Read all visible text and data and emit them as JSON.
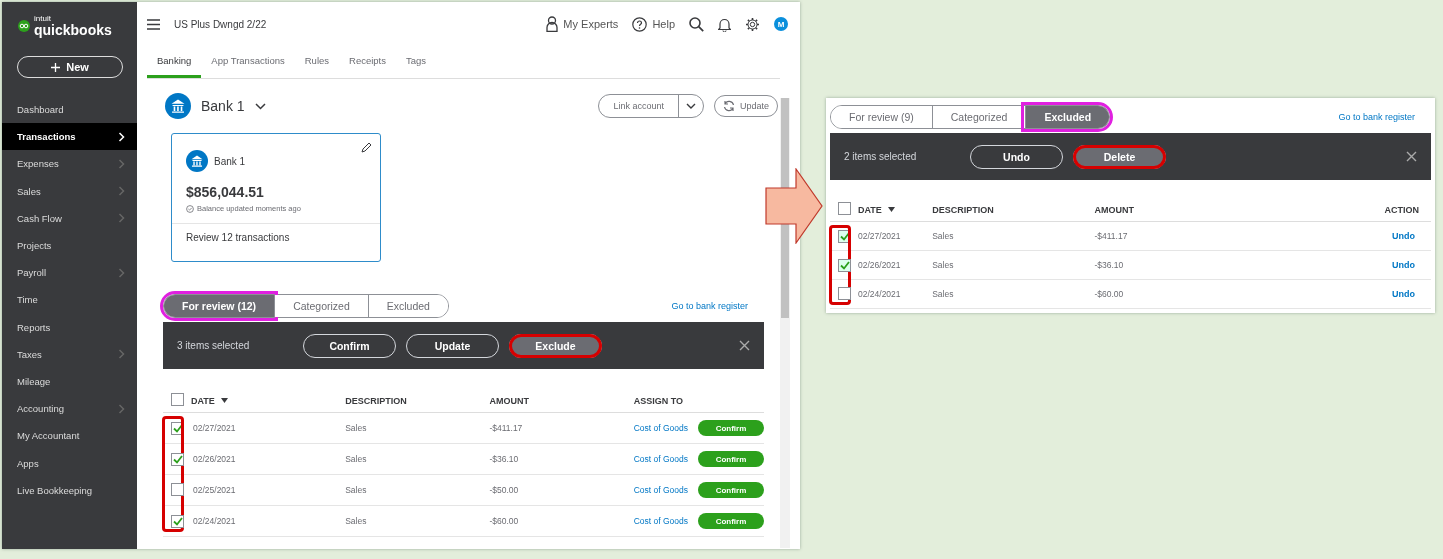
{
  "main_window": {
    "sidebar": {
      "logo_small": "intuit",
      "logo": "quickbooks",
      "new_button": "New",
      "items": [
        {
          "label": "Dashboard",
          "selected": false,
          "has_arrow": false
        },
        {
          "label": "Transactions",
          "selected": true,
          "has_arrow": true
        },
        {
          "label": "Expenses",
          "selected": false,
          "has_arrow": true
        },
        {
          "label": "Sales",
          "selected": false,
          "has_arrow": true
        },
        {
          "label": "Cash Flow",
          "selected": false,
          "has_arrow": true
        },
        {
          "label": "Projects",
          "selected": false,
          "has_arrow": false
        },
        {
          "label": "Payroll",
          "selected": false,
          "has_arrow": true
        },
        {
          "label": "Time",
          "selected": false,
          "has_arrow": false
        },
        {
          "label": "Reports",
          "selected": false,
          "has_arrow": false
        },
        {
          "label": "Taxes",
          "selected": false,
          "has_arrow": true
        },
        {
          "label": "Mileage",
          "selected": false,
          "has_arrow": false
        },
        {
          "label": "Accounting",
          "selected": false,
          "has_arrow": true
        },
        {
          "label": "My Accountant",
          "selected": false,
          "has_arrow": false
        },
        {
          "label": "Apps",
          "selected": false,
          "has_arrow": false
        },
        {
          "label": "Live Bookkeeping",
          "selected": false,
          "has_arrow": false
        }
      ]
    },
    "topbar": {
      "company": "US Plus Dwngd 2/22",
      "my_experts": "My Experts",
      "help": "Help",
      "avatar": "M"
    },
    "tabs": [
      {
        "label": "Banking",
        "selected": true
      },
      {
        "label": "App Transactions",
        "selected": false
      },
      {
        "label": "Rules",
        "selected": false
      },
      {
        "label": "Receipts",
        "selected": false
      },
      {
        "label": "Tags",
        "selected": false
      }
    ],
    "account": {
      "name": "Bank 1",
      "link_button": "Link account",
      "update_button": "Update"
    },
    "card": {
      "name": "Bank 1",
      "balance": "$856,044.51",
      "status": "Balance updated moments ago",
      "review": "Review 12 transactions"
    },
    "review": {
      "view_tabs": [
        {
          "label": "For review (12)",
          "selected": true,
          "circled": true
        },
        {
          "label": "Categorized",
          "selected": false,
          "circled": false
        },
        {
          "label": "Excluded",
          "selected": false,
          "circled": false
        }
      ],
      "register_link": "Go to bank register",
      "bulk_bar": {
        "count": "3 items selected",
        "buttons": [
          {
            "label": "Confirm",
            "selected": false,
            "circled": false
          },
          {
            "label": "Update",
            "selected": false,
            "circled": false
          },
          {
            "label": "Exclude",
            "selected": true,
            "circled": true
          }
        ]
      },
      "columns": [
        "DATE",
        "DESCRIPTION",
        "AMOUNT",
        "ASSIGN TO"
      ],
      "all_checked": false,
      "checkbox_column_circled": true,
      "rows": [
        {
          "checked": true,
          "date": "02/27/2021",
          "description": "Sales",
          "amount": "-$411.17",
          "assign_to": "Cost of Goods",
          "action": "Confirm"
        },
        {
          "checked": true,
          "date": "02/26/2021",
          "description": "Sales",
          "amount": "-$36.10",
          "assign_to": "Cost of Goods",
          "action": "Confirm"
        },
        {
          "checked": false,
          "date": "02/25/2021",
          "description": "Sales",
          "amount": "-$50.00",
          "assign_to": "Cost of Goods",
          "action": "Confirm"
        },
        {
          "checked": true,
          "date": "02/24/2021",
          "description": "Sales",
          "amount": "-$60.00",
          "assign_to": "Cost of Goods",
          "action": "Confirm"
        }
      ]
    }
  },
  "excluded_panel": {
    "view_tabs": [
      {
        "label": "For review (9)",
        "selected": false,
        "circled": false
      },
      {
        "label": "Categorized",
        "selected": false,
        "circled": false
      },
      {
        "label": "Excluded",
        "selected": true,
        "circled": true
      }
    ],
    "register_link": "Go to bank register",
    "bulk_bar": {
      "count": "2 items selected",
      "buttons": [
        {
          "label": "Undo",
          "selected": false,
          "circled": false
        },
        {
          "label": "Delete",
          "selected": true,
          "circled": true
        }
      ]
    },
    "columns": [
      "DATE",
      "DESCRIPTION",
      "AMOUNT",
      "ACTION"
    ],
    "all_checked": false,
    "checkbox_column_circled": true,
    "rows": [
      {
        "checked": true,
        "date": "02/27/2021",
        "description": "Sales",
        "amount": "-$411.17",
        "action": "Undo"
      },
      {
        "checked": true,
        "date": "02/26/2021",
        "description": "Sales",
        "amount": "-$36.10",
        "action": "Undo"
      },
      {
        "checked": false,
        "date": "02/24/2021",
        "description": "Sales",
        "amount": "-$60.00",
        "action": "Undo"
      }
    ]
  }
}
